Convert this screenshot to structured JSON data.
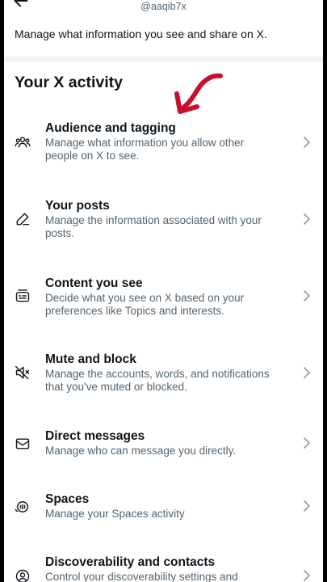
{
  "header": {
    "handle": "@aaqib7x",
    "subtitle": "Manage what information you see and share on X."
  },
  "section": {
    "title": "Your X activity"
  },
  "items": [
    {
      "icon": "people-icon",
      "title": "Audience and tagging",
      "description": "Manage what information you allow other people on X to see."
    },
    {
      "icon": "pencil-icon",
      "title": "Your posts",
      "description": "Manage the information associated with your posts."
    },
    {
      "icon": "content-icon",
      "title": "Content you see",
      "description": "Decide what you see on X based on your preferences like Topics and interests."
    },
    {
      "icon": "muted-speaker-icon",
      "title": "Mute and block",
      "description": "Manage the accounts, words, and notifications that you've muted or blocked."
    },
    {
      "icon": "envelope-icon",
      "title": "Direct messages",
      "description": "Manage who can message you directly."
    },
    {
      "icon": "spaces-icon",
      "title": "Spaces",
      "description": "Manage your Spaces activity"
    },
    {
      "icon": "discoverability-icon",
      "title": "Discoverability and contacts",
      "description": "Control your discoverability settings and"
    }
  ],
  "colors": {
    "text_primary": "#0f1419",
    "text_secondary": "#536471",
    "divider": "#eff3f4",
    "annotation_arrow": "#c8102e"
  }
}
